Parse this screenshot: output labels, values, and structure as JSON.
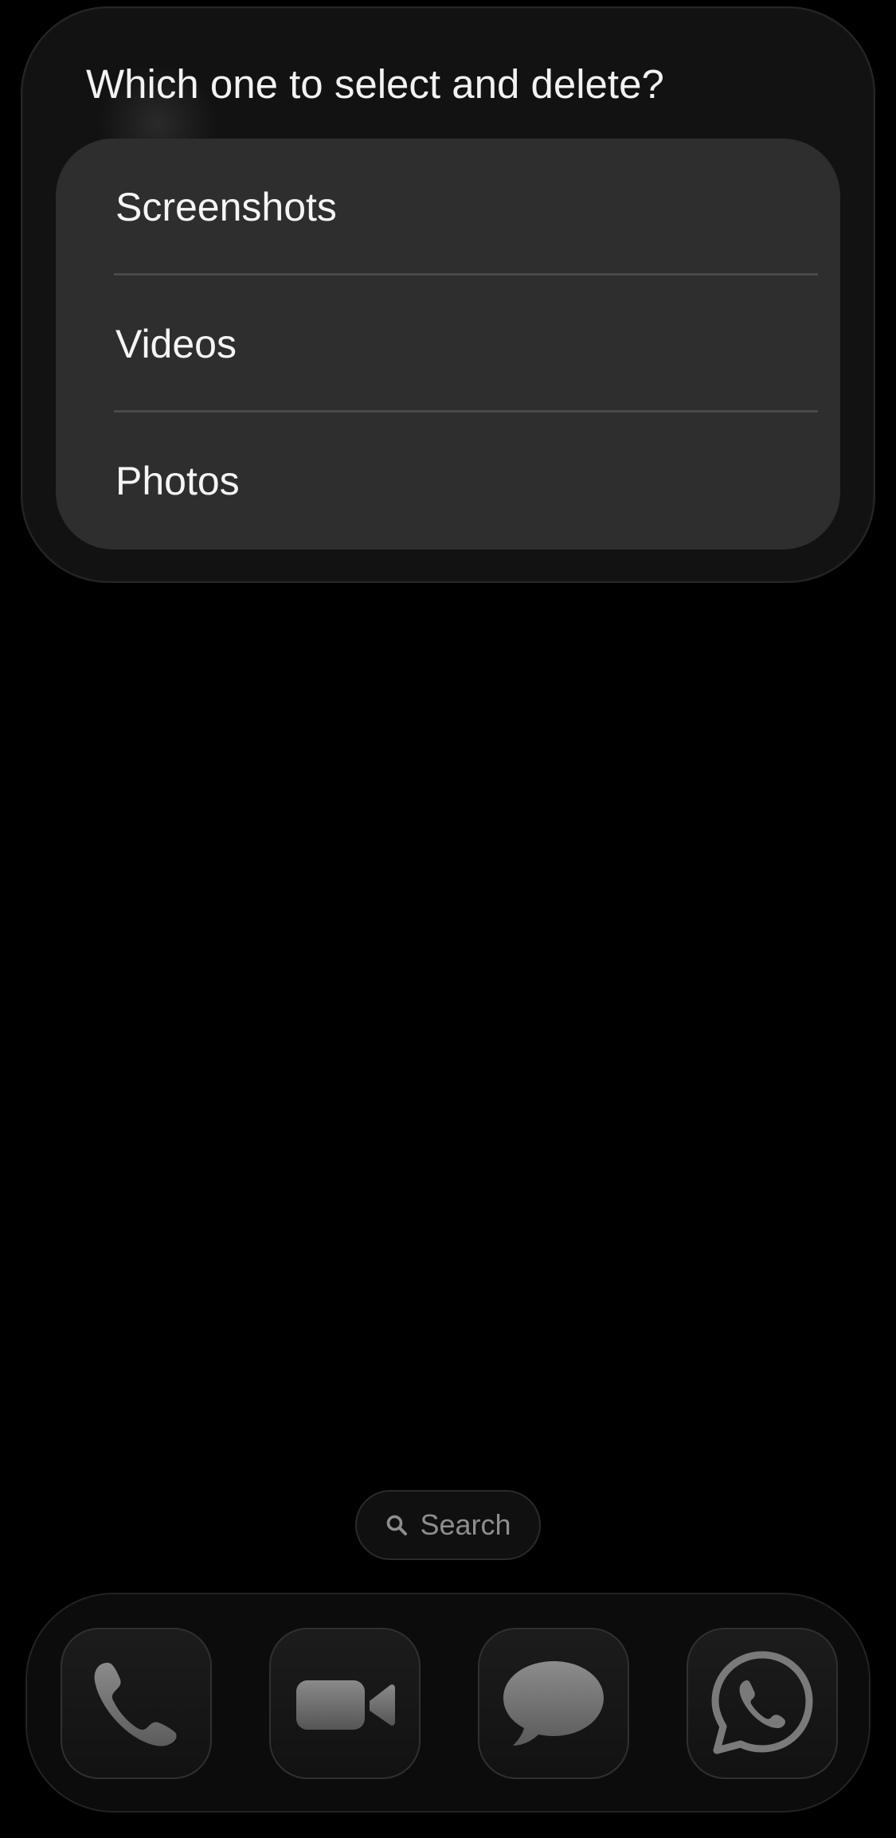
{
  "prompt": {
    "title": "Which one to select and delete?",
    "options": [
      {
        "label": "Screenshots"
      },
      {
        "label": "Videos"
      },
      {
        "label": "Photos"
      }
    ]
  },
  "search": {
    "label": "Search",
    "icon": "search-icon"
  },
  "dock": {
    "apps": [
      {
        "icon": "phone-icon"
      },
      {
        "icon": "facetime-video-icon"
      },
      {
        "icon": "messages-icon"
      },
      {
        "icon": "whatsapp-icon"
      }
    ]
  },
  "colors": {
    "background": "#000000",
    "sheet": "#121212",
    "card": "#2e2e2e",
    "text": "#f5f5f5",
    "muted_text": "#8e8e8e"
  }
}
